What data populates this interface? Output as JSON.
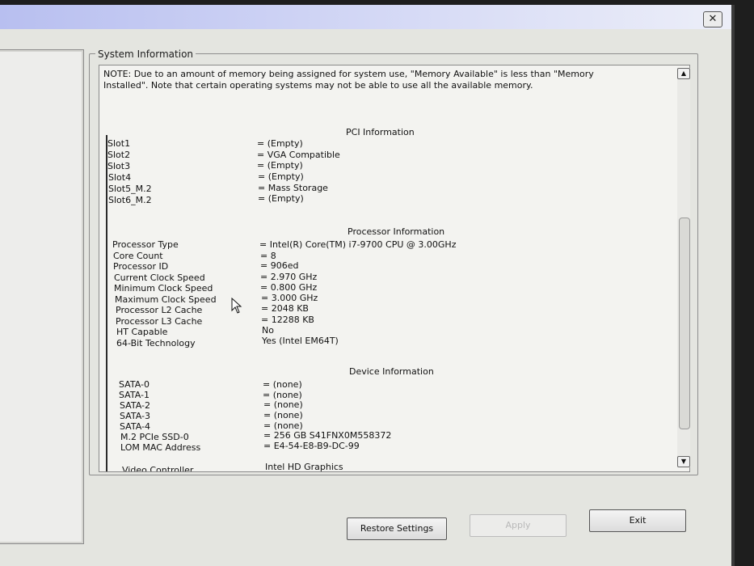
{
  "window": {
    "close_glyph": "✕",
    "group_title": "System Information"
  },
  "note_text": "NOTE: Due to an amount of memory being assigned for system use, \"Memory Available\" is less than \"Memory Installed\". Note that certain operating systems may not be able to use all the available memory.",
  "pci": {
    "title": "PCI Information",
    "rows": [
      {
        "label": "Slot1",
        "value": "= (Empty)"
      },
      {
        "label": "Slot2",
        "value": "= VGA Compatible"
      },
      {
        "label": "Slot3",
        "value": "= (Empty)"
      },
      {
        "label": "Slot4",
        "value": "= (Empty)"
      },
      {
        "label": "Slot5_M.2",
        "value": "= Mass Storage"
      },
      {
        "label": "Slot6_M.2",
        "value": "= (Empty)"
      }
    ]
  },
  "processor": {
    "title": "Processor Information",
    "rows": [
      {
        "label": "Processor Type",
        "value": "= Intel(R) Core(TM) i7-9700 CPU @ 3.00GHz"
      },
      {
        "label": "Core Count",
        "value": "= 8"
      },
      {
        "label": "Processor ID",
        "value": "= 906ed"
      },
      {
        "label": "Current Clock Speed",
        "value": "= 2.970 GHz"
      },
      {
        "label": "Minimum Clock Speed",
        "value": "= 0.800 GHz"
      },
      {
        "label": "Maximum Clock Speed",
        "value": "= 3.000 GHz"
      },
      {
        "label": "Processor L2 Cache",
        "value": "= 2048 KB"
      },
      {
        "label": "Processor L3 Cache",
        "value": "= 12288 KB"
      },
      {
        "label": "HT Capable",
        "value": "No"
      },
      {
        "label": "64-Bit Technology",
        "value": "Yes (Intel EM64T)"
      }
    ]
  },
  "device": {
    "title": "Device Information",
    "rows": [
      {
        "label": "SATA-0",
        "value": "= (none)"
      },
      {
        "label": "SATA-1",
        "value": "= (none)"
      },
      {
        "label": "SATA-2",
        "value": "= (none)"
      },
      {
        "label": "SATA-3",
        "value": "= (none)"
      },
      {
        "label": "SATA-4",
        "value": "= (none)"
      },
      {
        "label": "M.2 PCIe SSD-0",
        "value": "= 256 GB S41FNX0M558372"
      },
      {
        "label": "LOM MAC Address",
        "value": "= E4-54-E8-B9-DC-99"
      }
    ],
    "video_label": "Video Controller",
    "video_value": "Intel HD Graphics"
  },
  "buttons": {
    "restore": "Restore Settings",
    "apply": "Apply",
    "exit": "Exit"
  },
  "scroll": {
    "up_glyph": "▲",
    "down_glyph": "▼"
  }
}
